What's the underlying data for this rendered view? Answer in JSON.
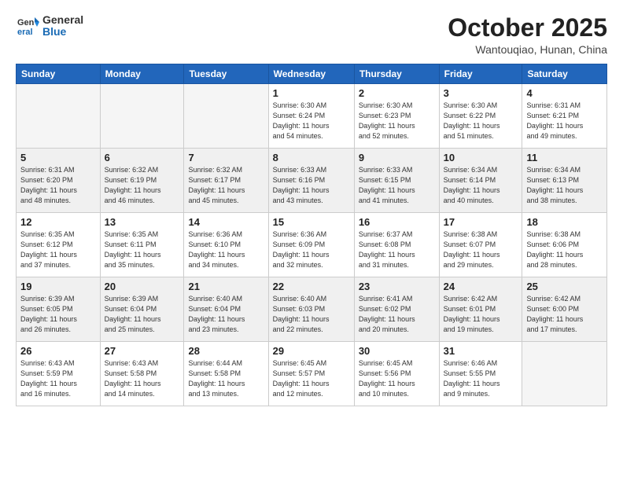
{
  "header": {
    "logo": {
      "general": "General",
      "blue": "Blue"
    },
    "title": "October 2025",
    "location": "Wantouqiao, Hunan, China"
  },
  "weekdays": [
    "Sunday",
    "Monday",
    "Tuesday",
    "Wednesday",
    "Thursday",
    "Friday",
    "Saturday"
  ],
  "weeks": [
    [
      {
        "day": "",
        "info": ""
      },
      {
        "day": "",
        "info": ""
      },
      {
        "day": "",
        "info": ""
      },
      {
        "day": "1",
        "info": "Sunrise: 6:30 AM\nSunset: 6:24 PM\nDaylight: 11 hours\nand 54 minutes."
      },
      {
        "day": "2",
        "info": "Sunrise: 6:30 AM\nSunset: 6:23 PM\nDaylight: 11 hours\nand 52 minutes."
      },
      {
        "day": "3",
        "info": "Sunrise: 6:30 AM\nSunset: 6:22 PM\nDaylight: 11 hours\nand 51 minutes."
      },
      {
        "day": "4",
        "info": "Sunrise: 6:31 AM\nSunset: 6:21 PM\nDaylight: 11 hours\nand 49 minutes."
      }
    ],
    [
      {
        "day": "5",
        "info": "Sunrise: 6:31 AM\nSunset: 6:20 PM\nDaylight: 11 hours\nand 48 minutes."
      },
      {
        "day": "6",
        "info": "Sunrise: 6:32 AM\nSunset: 6:19 PM\nDaylight: 11 hours\nand 46 minutes."
      },
      {
        "day": "7",
        "info": "Sunrise: 6:32 AM\nSunset: 6:17 PM\nDaylight: 11 hours\nand 45 minutes."
      },
      {
        "day": "8",
        "info": "Sunrise: 6:33 AM\nSunset: 6:16 PM\nDaylight: 11 hours\nand 43 minutes."
      },
      {
        "day": "9",
        "info": "Sunrise: 6:33 AM\nSunset: 6:15 PM\nDaylight: 11 hours\nand 41 minutes."
      },
      {
        "day": "10",
        "info": "Sunrise: 6:34 AM\nSunset: 6:14 PM\nDaylight: 11 hours\nand 40 minutes."
      },
      {
        "day": "11",
        "info": "Sunrise: 6:34 AM\nSunset: 6:13 PM\nDaylight: 11 hours\nand 38 minutes."
      }
    ],
    [
      {
        "day": "12",
        "info": "Sunrise: 6:35 AM\nSunset: 6:12 PM\nDaylight: 11 hours\nand 37 minutes."
      },
      {
        "day": "13",
        "info": "Sunrise: 6:35 AM\nSunset: 6:11 PM\nDaylight: 11 hours\nand 35 minutes."
      },
      {
        "day": "14",
        "info": "Sunrise: 6:36 AM\nSunset: 6:10 PM\nDaylight: 11 hours\nand 34 minutes."
      },
      {
        "day": "15",
        "info": "Sunrise: 6:36 AM\nSunset: 6:09 PM\nDaylight: 11 hours\nand 32 minutes."
      },
      {
        "day": "16",
        "info": "Sunrise: 6:37 AM\nSunset: 6:08 PM\nDaylight: 11 hours\nand 31 minutes."
      },
      {
        "day": "17",
        "info": "Sunrise: 6:38 AM\nSunset: 6:07 PM\nDaylight: 11 hours\nand 29 minutes."
      },
      {
        "day": "18",
        "info": "Sunrise: 6:38 AM\nSunset: 6:06 PM\nDaylight: 11 hours\nand 28 minutes."
      }
    ],
    [
      {
        "day": "19",
        "info": "Sunrise: 6:39 AM\nSunset: 6:05 PM\nDaylight: 11 hours\nand 26 minutes."
      },
      {
        "day": "20",
        "info": "Sunrise: 6:39 AM\nSunset: 6:04 PM\nDaylight: 11 hours\nand 25 minutes."
      },
      {
        "day": "21",
        "info": "Sunrise: 6:40 AM\nSunset: 6:04 PM\nDaylight: 11 hours\nand 23 minutes."
      },
      {
        "day": "22",
        "info": "Sunrise: 6:40 AM\nSunset: 6:03 PM\nDaylight: 11 hours\nand 22 minutes."
      },
      {
        "day": "23",
        "info": "Sunrise: 6:41 AM\nSunset: 6:02 PM\nDaylight: 11 hours\nand 20 minutes."
      },
      {
        "day": "24",
        "info": "Sunrise: 6:42 AM\nSunset: 6:01 PM\nDaylight: 11 hours\nand 19 minutes."
      },
      {
        "day": "25",
        "info": "Sunrise: 6:42 AM\nSunset: 6:00 PM\nDaylight: 11 hours\nand 17 minutes."
      }
    ],
    [
      {
        "day": "26",
        "info": "Sunrise: 6:43 AM\nSunset: 5:59 PM\nDaylight: 11 hours\nand 16 minutes."
      },
      {
        "day": "27",
        "info": "Sunrise: 6:43 AM\nSunset: 5:58 PM\nDaylight: 11 hours\nand 14 minutes."
      },
      {
        "day": "28",
        "info": "Sunrise: 6:44 AM\nSunset: 5:58 PM\nDaylight: 11 hours\nand 13 minutes."
      },
      {
        "day": "29",
        "info": "Sunrise: 6:45 AM\nSunset: 5:57 PM\nDaylight: 11 hours\nand 12 minutes."
      },
      {
        "day": "30",
        "info": "Sunrise: 6:45 AM\nSunset: 5:56 PM\nDaylight: 11 hours\nand 10 minutes."
      },
      {
        "day": "31",
        "info": "Sunrise: 6:46 AM\nSunset: 5:55 PM\nDaylight: 11 hours\nand 9 minutes."
      },
      {
        "day": "",
        "info": ""
      }
    ]
  ]
}
